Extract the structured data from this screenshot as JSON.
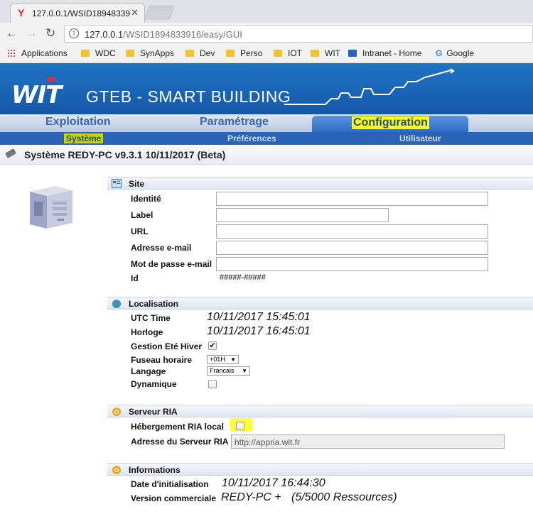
{
  "browser": {
    "tab_title": "127.0.0.1/WSID18948339",
    "url_host": "127.0.0.1",
    "url_rest": "/WSID1894833916/easy/GUI",
    "bookmarks": [
      "Applications",
      "WDC",
      "SynApps",
      "Dev",
      "Perso",
      "IOT",
      "WIT",
      "Intranet - Home",
      "Google"
    ]
  },
  "app": {
    "logo": "WIT",
    "title": "GTEB - SMART BUILDING",
    "main_tabs": [
      "Exploitation",
      "Paramétrage",
      "Configuration"
    ],
    "sub_tabs": [
      "Système",
      "Préférences",
      "Utilisateur"
    ],
    "page_title": "Système REDY-PC v9.3.1 10/11/2017 (Beta)"
  },
  "site": {
    "title": "Site",
    "labels": {
      "identite": "Identité",
      "label": "Label",
      "url": "URL",
      "email": "Adresse e-mail",
      "password": "Mot de passe e-mail",
      "id": "Id"
    },
    "id_value": "#####-#####"
  },
  "localisation": {
    "title": "Localisation",
    "utc_label": "UTC Time",
    "utc_value": "10/11/2017 15:45:01",
    "horloge_label": "Horloge",
    "horloge_value": "10/11/2017 16:45:01",
    "gestion_label": "Gestion Eté Hiver",
    "gestion_checked": true,
    "fuseau_label": "Fuseau horaire",
    "fuseau_value": "+01H",
    "langage_label": "Langage",
    "langage_value": "Francais",
    "dynamique_label": "Dynamique",
    "dynamique_checked": false
  },
  "ria": {
    "title": "Serveur RIA",
    "hebergement_label": "Hébergement RIA local",
    "adresse_label": "Adresse du Serveur RIA",
    "adresse_value": "http://appria.wit.fr"
  },
  "informations": {
    "title": "Informations",
    "init_label": "Date d'initialisation",
    "init_value": "10/11/2017 16:44:30",
    "version_label": "Version commerciale",
    "version_value": "REDY-PC +",
    "resources_value": "(5/5000 Ressources)"
  },
  "colors": {
    "banner": "#1a66b8",
    "highlight": "#ffff00",
    "subtab_highlight": "#c7d400"
  }
}
